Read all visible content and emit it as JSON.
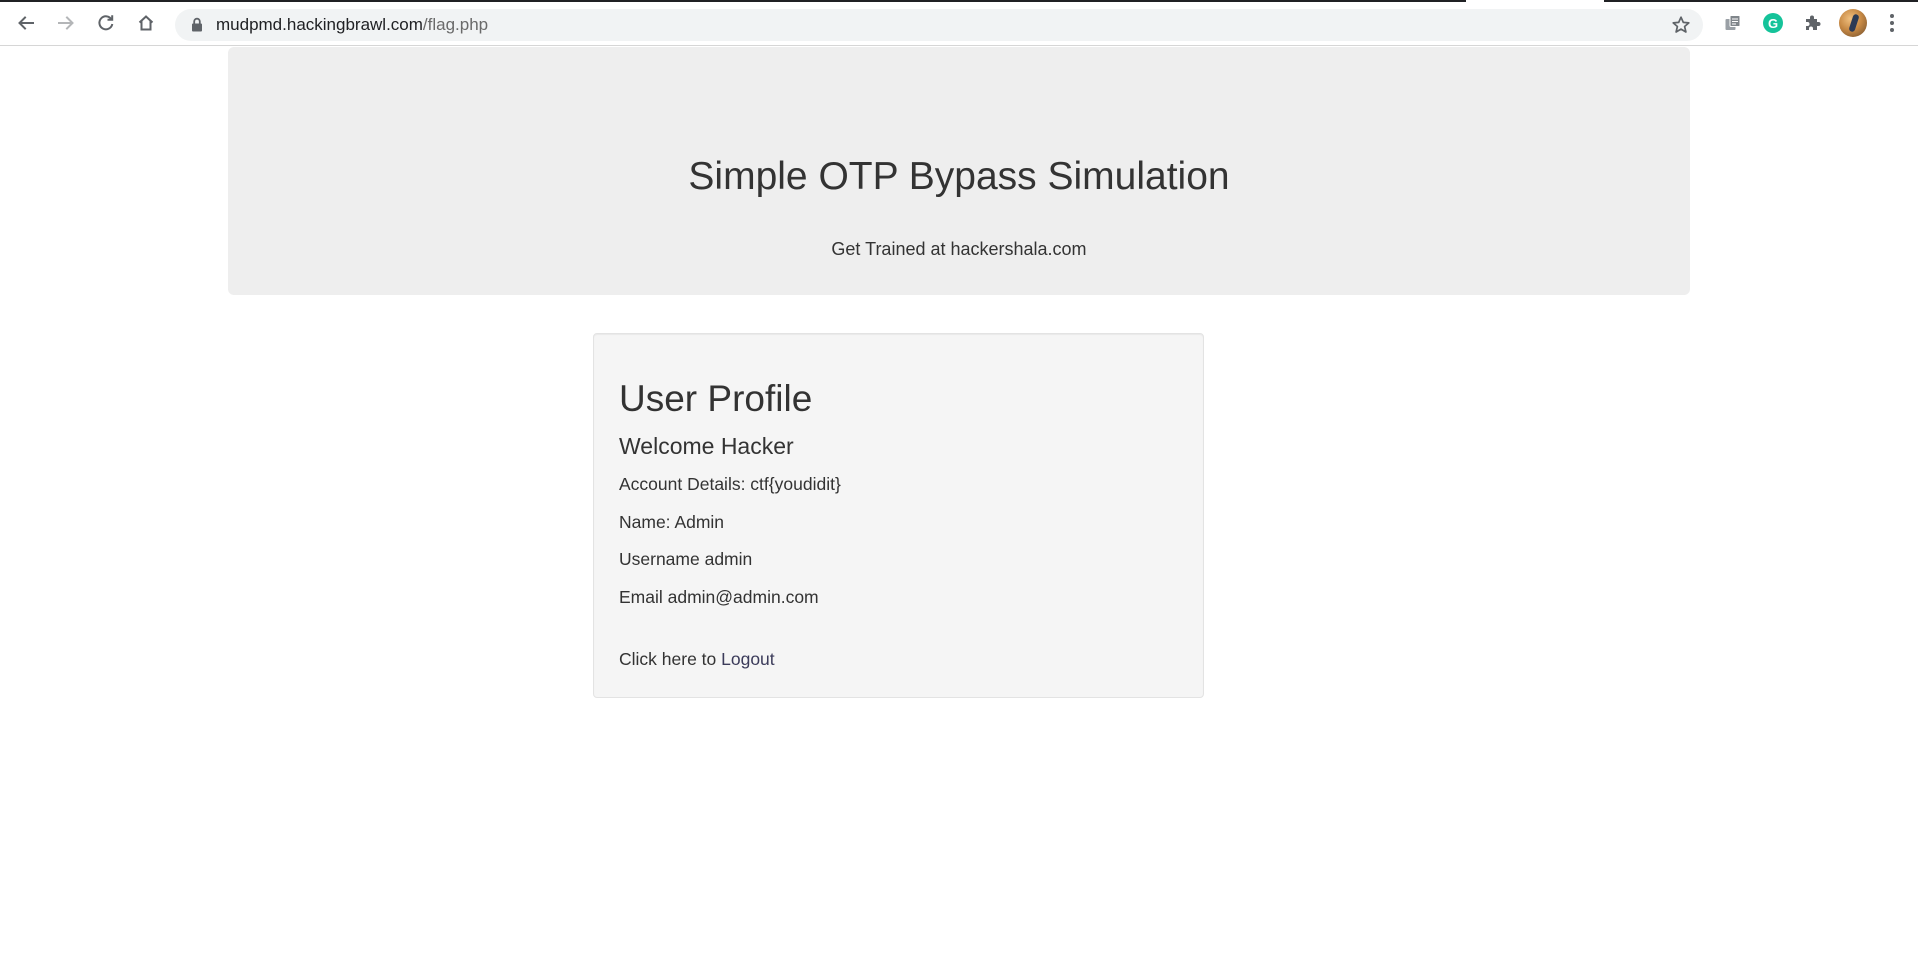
{
  "browser": {
    "url_host": "mudpmd.hackingbrawl.com",
    "url_path": "/flag.php",
    "icons": [
      "back-icon",
      "forward-icon",
      "reload-icon",
      "home-icon",
      "lock-icon",
      "bookmark-star-icon",
      "extension-copy-icon",
      "grammarly-icon",
      "extensions-puzzle-icon",
      "profile-avatar",
      "menu-dots-icon"
    ],
    "grammarly_letter": "G"
  },
  "header": {
    "title": "Simple OTP Bypass Simulation",
    "subtitle": "Get Trained at hackershala.com"
  },
  "profile": {
    "title": "User Profile",
    "welcome": "Welcome Hacker",
    "account_details": "Account Details: ctf{youdidit}",
    "name": "Name: Admin",
    "username": "Username admin",
    "email": "Email admin@admin.com",
    "logout_prefix": "Click here to ",
    "logout_link": "Logout"
  }
}
